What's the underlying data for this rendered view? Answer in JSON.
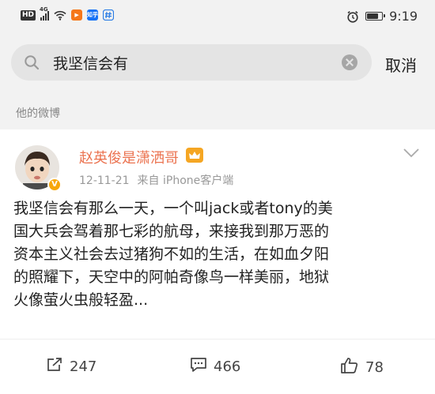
{
  "status_bar": {
    "hd_badge": "HD",
    "network": "4G",
    "app_icon_label": "知乎",
    "time": "9:19",
    "battery_level": 0.8
  },
  "search": {
    "query": "我坚信会有",
    "cancel_label": "取消"
  },
  "section_label": "他的微博",
  "post": {
    "username": "赵英俊是潇洒哥",
    "date": "12-11-21",
    "source": "来自 iPhone客户端",
    "text_lines": [
      "我坚信会有那么一天，一个叫jack或者tony的美",
      "国大兵会驾着那七彩的航母，来接我到那万恶的",
      "资本主义社会去过猪狗不如的生活，在如血夕阳",
      "的照耀下，天空中的阿帕奇像鸟一样美丽，地狱",
      "火像萤火虫般轻盈..."
    ],
    "repost_count": "247",
    "comment_count": "466",
    "like_count": "78"
  },
  "colors": {
    "username": "#eb7350",
    "verify_badge": "#f7a70b",
    "background": "#f2f2f2"
  },
  "icons": [
    "hd-badge",
    "signal-icon",
    "wifi-icon",
    "video-app-icon",
    "zhihu-app-icon",
    "hash-icon",
    "alarm-clock-icon",
    "battery-icon",
    "search-icon",
    "clear-icon",
    "avatar",
    "verify-badge",
    "vip-icon",
    "chevron-down-icon",
    "repost-icon",
    "comment-icon",
    "like-icon"
  ]
}
